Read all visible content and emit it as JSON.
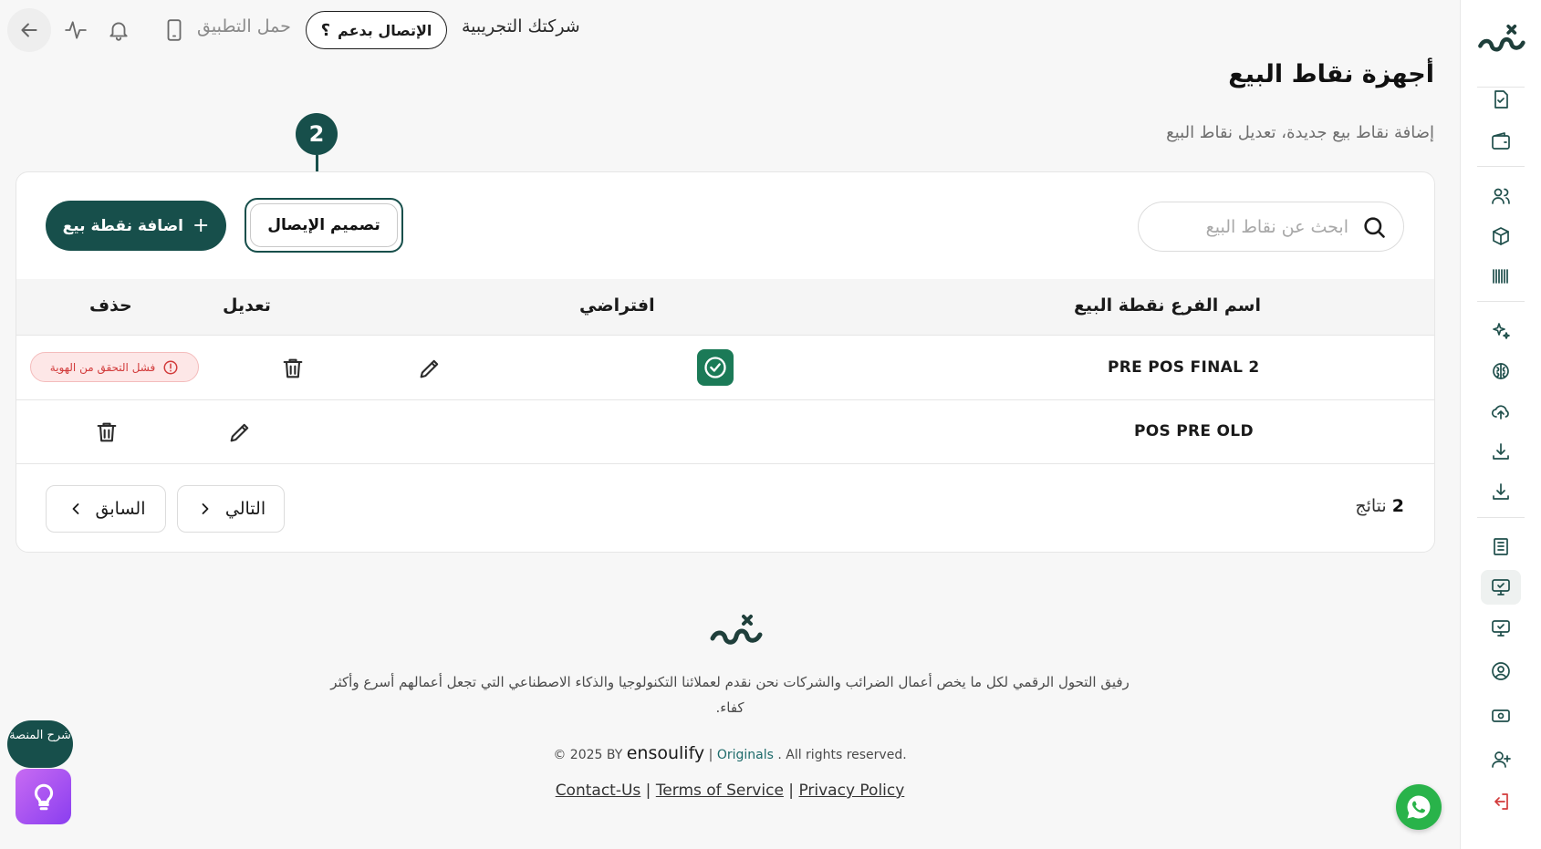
{
  "topbar": {
    "company_name": "شركتك التجريبية",
    "support_label": "الإتصال بدعم",
    "support_icon": "؟",
    "download_app": "حمل التطبيق",
    "icons": [
      "back-arrow-icon",
      "activity-icon",
      "bell-icon",
      "phone-icon"
    ]
  },
  "page": {
    "title": "أجهزة نقاط البيع",
    "subtitle": "إضافة نقاط بيع جديدة، تعديل نقاط البيع"
  },
  "step_marker": "2",
  "toolbar": {
    "search_placeholder": "ابحث عن نقاط البيع",
    "add_label": "اضافة نقطة بيع",
    "add_icon": "+",
    "design_label": "تصميم الإيصال"
  },
  "table": {
    "headers": {
      "name": "اسم الفرع نقطة البيع",
      "default": "افتراضي",
      "edit": "تعديل",
      "delete": "حذف"
    },
    "rows": [
      {
        "name": "PRE POS FINAL 2",
        "is_default": true,
        "status": "فشل التحقق من الهوية"
      },
      {
        "name": "POS PRE OLD",
        "is_default": false,
        "status": ""
      }
    ]
  },
  "pagination": {
    "count": "2",
    "results_label": "نتائج",
    "next_label": "التالي",
    "prev_label": "السابق"
  },
  "footer": {
    "description": "رفيق التحول الرقمي لكل ما يخص أعمال الضرائب والشركات نحن نقدم لعملائنا التكنولوجيا والذكاء الاصطناعي التي تجعل أعمالهم أسرع وأكثر كفاء.",
    "copyright_prefix": "© 2025 BY",
    "brand": "ensoulify",
    "originals": "Originals",
    "rights": ". All rights reserved.",
    "links": [
      "Contact-Us",
      "Terms of Service",
      "Privacy Policy"
    ]
  },
  "floating": {
    "explain_label": "شرح المنصة"
  },
  "colors": {
    "primary": "#174f4b",
    "success": "#1b7a57",
    "danger": "#d23b3b",
    "whatsapp": "#29b34a"
  }
}
